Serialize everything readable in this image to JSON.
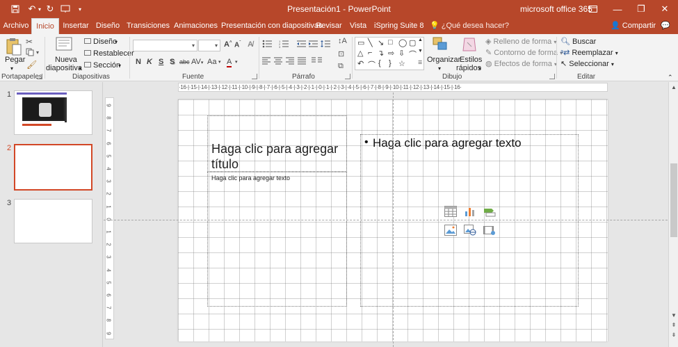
{
  "window": {
    "title": "Presentación1  -  PowerPoint",
    "account": "microsoft office 365"
  },
  "colors": {
    "accent": "#b7472a",
    "selected_thumb": "#d24726"
  },
  "tabs": [
    {
      "label": "Archivo"
    },
    {
      "label": "Inicio"
    },
    {
      "label": "Insertar"
    },
    {
      "label": "Diseño"
    },
    {
      "label": "Transiciones"
    },
    {
      "label": "Animaciones"
    },
    {
      "label": "Presentación con diapositivas"
    },
    {
      "label": "Revisar"
    },
    {
      "label": "Vista"
    },
    {
      "label": "iSpring Suite 8"
    }
  ],
  "active_tab": "Inicio",
  "tell_me": "¿Qué desea hacer?",
  "share": "Compartir",
  "ribbon": {
    "clipboard": {
      "paste": "Pegar",
      "group": "Portapapeles"
    },
    "slides": {
      "new_slide_line1": "Nueva",
      "new_slide_line2": "diapositiva",
      "layout": "Diseño",
      "reset": "Restablecer",
      "section": "Sección",
      "group": "Diapositivas"
    },
    "font": {
      "group": "Fuente",
      "bold": "N",
      "italic": "K",
      "underline": "S",
      "shadow": "S",
      "strike": "abc",
      "case": "Aa",
      "color": "A"
    },
    "paragraph": {
      "group": "Párrafo"
    },
    "drawing": {
      "arrange_line1": "Organizar",
      "styles_line1": "Estilos",
      "styles_line2": "rápidos",
      "fill": "Relleno de forma",
      "outline": "Contorno de forma",
      "effects": "Efectos de forma",
      "group": "Dibujo"
    },
    "editing": {
      "find": "Buscar",
      "replace": "Reemplazar",
      "select": "Seleccionar",
      "group": "Editar"
    }
  },
  "thumbnails": [
    {
      "number": "1"
    },
    {
      "number": "2"
    },
    {
      "number": "3"
    }
  ],
  "slide": {
    "title_placeholder": "Haga clic para agregar título",
    "subtitle_placeholder": "Haga clic para agregar texto",
    "body_placeholder": "Haga clic para agregar texto",
    "bullet": "•"
  },
  "ruler": {
    "h_ticks": "·16·|·15·|·14·|·13·|·12·|·11·|·10·|·9·|·8·|·7·|·6·|·5·|·4·|·3·|·2·|·1·|·0·|·1·|·2·|·3·|·4·|·5·|·6·|·7·|·8·|·9·|·10·|·11·|·12·|·13·|·14·|·15·|·16·",
    "v_ticks": [
      "9",
      "8",
      "7",
      "6",
      "5",
      "4",
      "3",
      "2",
      "1",
      "0",
      "1",
      "2",
      "3",
      "4",
      "5",
      "6",
      "7",
      "8",
      "9"
    ]
  }
}
